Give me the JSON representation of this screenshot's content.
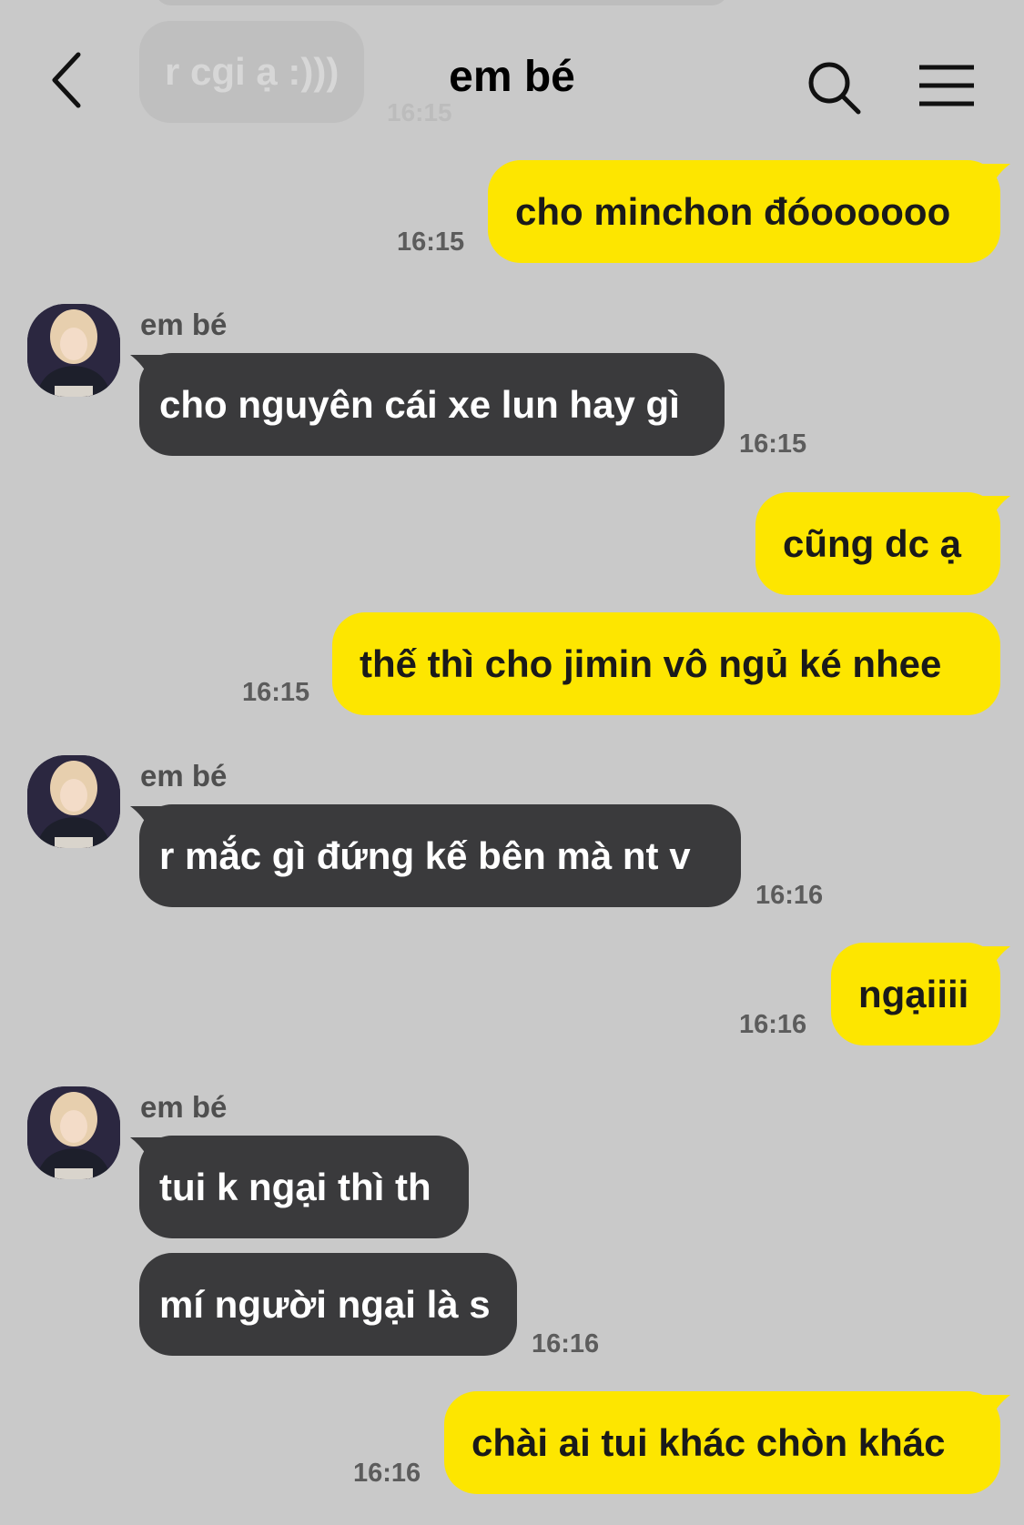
{
  "header": {
    "title": "em bé"
  },
  "faded_message": {
    "text": "r cgi ạ :)))",
    "time": "16:15"
  },
  "messages": [
    {
      "from": "me",
      "text": "cho minchon đóoooooo",
      "time": "16:15"
    },
    {
      "from": "them",
      "sender": "em bé",
      "text": "cho nguyên cái xe lun hay gì",
      "time": "16:15"
    },
    {
      "from": "me",
      "text": "cũng dc ạ",
      "time": ""
    },
    {
      "from": "me",
      "text": "thế thì cho jimin vô ngủ ké nhee",
      "time": "16:15"
    },
    {
      "from": "them",
      "sender": "em bé",
      "text": "r mắc gì đứng kế bên mà nt v",
      "time": "16:16"
    },
    {
      "from": "me",
      "text": "ngạiiii",
      "time": "16:16"
    },
    {
      "from": "them",
      "sender": "em bé",
      "text": "tui k ngại thì th",
      "time": ""
    },
    {
      "from": "them",
      "text": "mí người ngại là s",
      "time": "16:16"
    },
    {
      "from": "me",
      "text": "chài ai tui khác chòn khác",
      "time": "16:16"
    }
  ],
  "colors": {
    "background": "#c9c9c9",
    "my_bubble": "#fde600",
    "their_bubble": "#3a3a3c"
  },
  "icons": [
    "back-arrow-icon",
    "search-icon",
    "menu-icon"
  ]
}
